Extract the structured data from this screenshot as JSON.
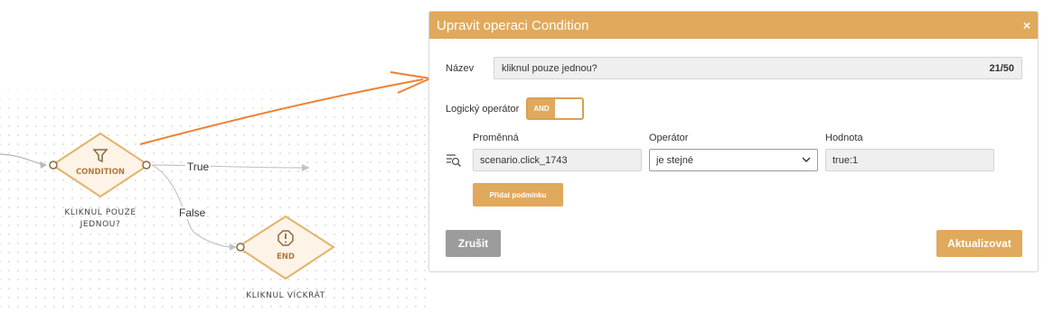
{
  "canvas": {
    "condition_node": {
      "type_label": "CONDITION",
      "name_line1": "KLIKNUL POUZE",
      "name_line2": "JEDNOU?"
    },
    "end_node": {
      "type_label": "END",
      "name": "KLIKNUL VÍCKRÁT"
    },
    "edges": {
      "true_label": "True",
      "false_label": "False"
    }
  },
  "modal": {
    "title": "Upravit operaci Condition",
    "close": "×",
    "name_label": "Název",
    "name_value": "kliknul pouze jednou?",
    "name_count": "21/50",
    "logic_label": "Logický operátor",
    "logic_value": "AND",
    "columns": {
      "variable": "Proměnná",
      "operator": "Operátor",
      "value": "Hodnota"
    },
    "condition": {
      "variable": "scenario.click_1743",
      "operator": "je stejné",
      "value": "true:1"
    },
    "add_condition": "Přidat podmínku",
    "cancel": "Zrušit",
    "update": "Aktualizovat"
  },
  "colors": {
    "accent": "#e0a95c",
    "arrow": "#f08030",
    "node_fill": "#fdf3e6",
    "node_stroke": "#e2b36c",
    "cancel": "#9c9c9c"
  },
  "icons": [
    "filter-icon",
    "alert-octagon-icon",
    "close-icon",
    "chevron-down-icon",
    "filter-list-search-icon"
  ]
}
